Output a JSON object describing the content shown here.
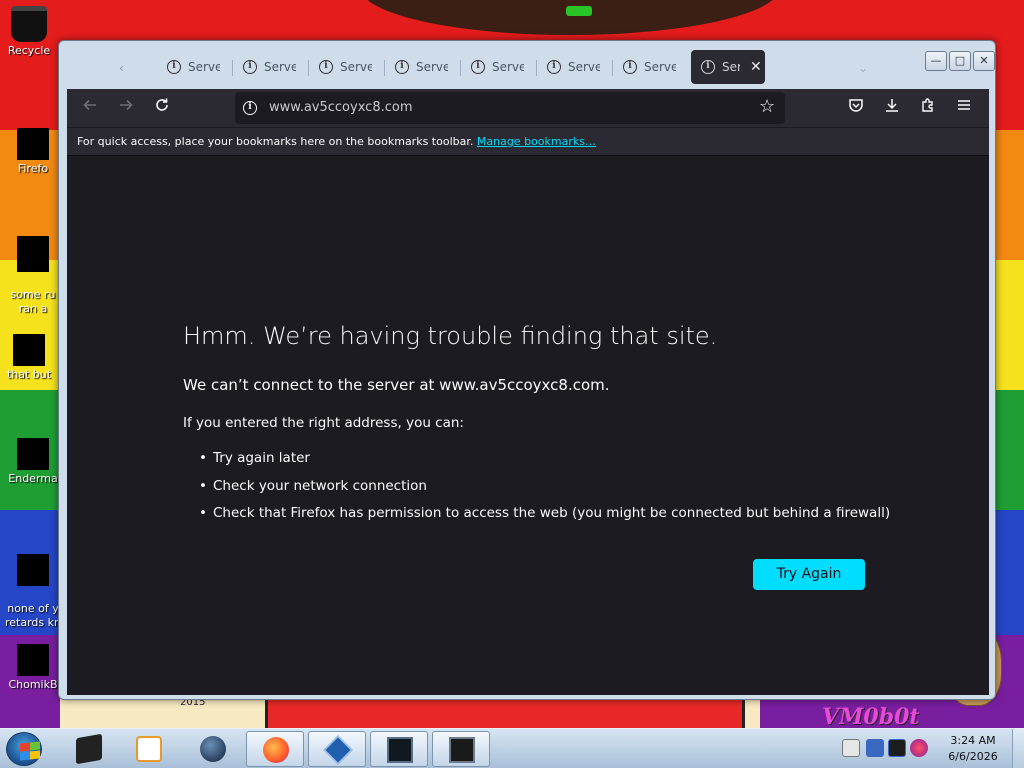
{
  "desktop": {
    "icons": [
      {
        "label": "Recycle"
      },
      {
        "label": "Firefo"
      },
      {
        "label": "some ru\nran a"
      },
      {
        "label": "that but"
      },
      {
        "label": "Enderma"
      },
      {
        "label": "none of y\nretards kn"
      },
      {
        "label": "ChomikB"
      }
    ],
    "wallpaper_text": {
      "year": "2015",
      "brand": "VM0b0t"
    }
  },
  "browser": {
    "tabs": [
      {
        "title": "Server"
      },
      {
        "title": "Server"
      },
      {
        "title": "Server"
      },
      {
        "title": "Server"
      },
      {
        "title": "Server"
      },
      {
        "title": "Server"
      },
      {
        "title": "Server"
      },
      {
        "title": "Ser",
        "active": true
      }
    ],
    "tab_close_glyph": "✕",
    "window_controls": {
      "minimize": "—",
      "maximize": "□",
      "close": "✕"
    },
    "toolbar": {
      "back_icon": "arrow-left-icon",
      "forward_icon": "arrow-right-icon",
      "reload_icon": "reload-icon",
      "url": "www.av5ccoyxc8.com",
      "bookmark_star_icon": "star-icon",
      "right_icons": [
        "pocket-icon",
        "download-icon",
        "extensions-icon",
        "menu-icon"
      ]
    },
    "bookmarks_bar": {
      "text": "For quick access, place your bookmarks here on the bookmarks toolbar.",
      "link": "Manage bookmarks…"
    },
    "error_page": {
      "title": "Hmm. We’re having trouble finding that site.",
      "description": "We can’t connect to the server at www.av5ccoyxc8.com.",
      "subtitle": "If you entered the right address, you can:",
      "suggestions": [
        "Try again later",
        "Check your network connection",
        "Check that Firefox has permission to access the web (you might be connected but behind a firewall)"
      ],
      "button": "Try Again",
      "accent_color": "#00ddff",
      "background_color": "#1c1b22"
    }
  },
  "taskbar": {
    "buttons": [
      "explorer-icon",
      "media-player-icon",
      "globe-icon",
      "firefox-icon",
      "virtualbox-icon",
      "monitor-icon",
      "terminal-icon"
    ],
    "active_button": "firefox-icon",
    "clock": {
      "time": "3:24 AM",
      "date": "6/6/2026"
    }
  }
}
